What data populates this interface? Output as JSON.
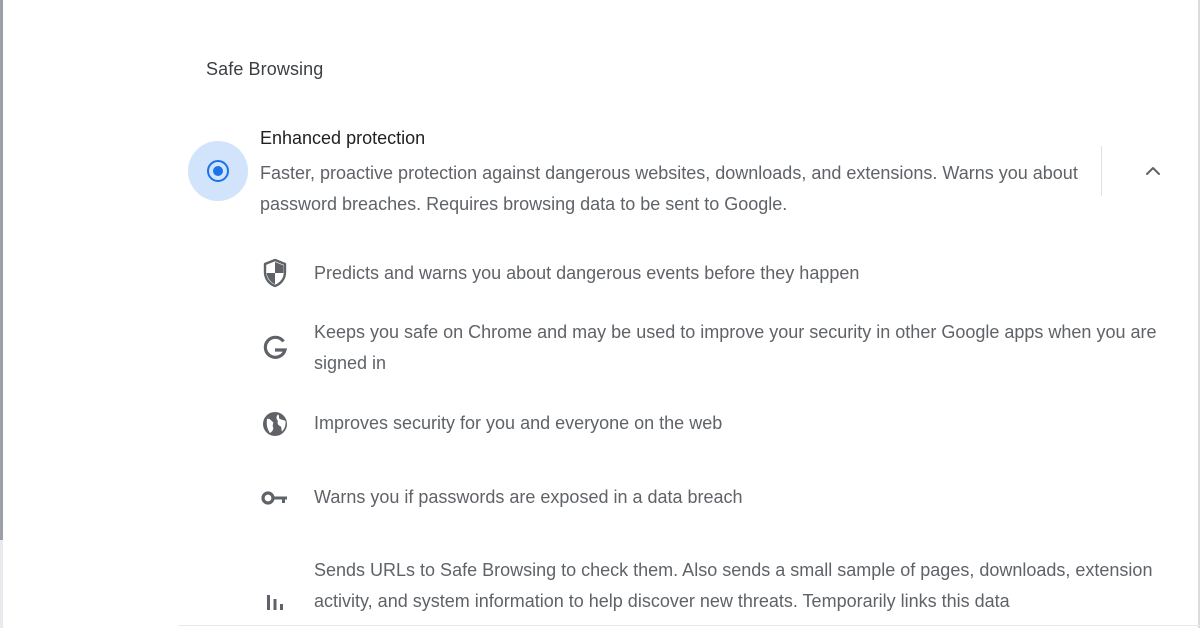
{
  "safe_browsing": {
    "section_title": "Safe Browsing",
    "enhanced": {
      "label": "Enhanced protection",
      "description": "Faster, proactive protection against dangerous websites, downloads, and extensions. Warns you about password breaches. Requires browsing data to be sent to Google.",
      "selected": true,
      "expanded": true
    },
    "features": [
      {
        "icon": "shield-icon",
        "text": "Predicts and warns you about dangerous events before they happen"
      },
      {
        "icon": "google-g-icon",
        "text": "Keeps you safe on Chrome and may be used to improve your security in other Google apps when you are signed in"
      },
      {
        "icon": "globe-icon",
        "text": "Improves security for you and everyone on the web"
      },
      {
        "icon": "key-icon",
        "text": "Warns you if passwords are exposed in a data breach"
      },
      {
        "icon": "bar-chart-icon",
        "text": "Sends URLs to Safe Browsing to check them. Also sends a small sample of pages, downloads, extension activity, and system information to help discover new threats. Temporarily links this data"
      }
    ]
  },
  "colors": {
    "accent": "#1a73e8",
    "accent_halo": "#d2e3fc",
    "primary_text": "#202124",
    "secondary_text": "#5f6368",
    "icon": "#5f6368"
  }
}
